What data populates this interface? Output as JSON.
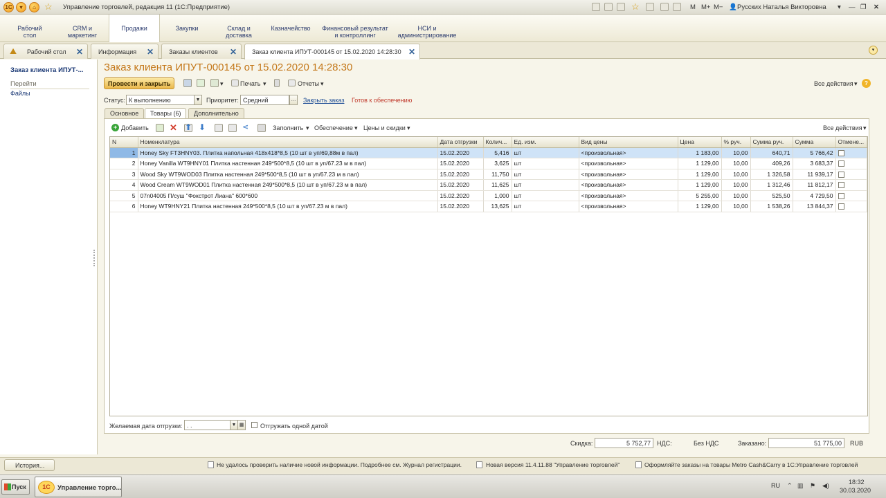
{
  "window": {
    "title": "Управление торговлей, редакция 11  (1С:Предприятие)",
    "memory_buttons": [
      "M",
      "M+",
      "M−"
    ],
    "user": "Русских Наталья Викторовна"
  },
  "sections": [
    {
      "label": "Рабочий\nстол"
    },
    {
      "label": "CRM и\nмаркетинг"
    },
    {
      "label": "Продажи"
    },
    {
      "label": "Закупки"
    },
    {
      "label": "Склад и\nдоставка"
    },
    {
      "label": "Казначейство"
    },
    {
      "label": "Финансовый результат\nи контроллинг"
    },
    {
      "label": "НСИ и\nадминистрирование"
    }
  ],
  "open_tabs": [
    {
      "label": "Рабочий стол"
    },
    {
      "label": "Информация"
    },
    {
      "label": "Заказы клиентов"
    },
    {
      "label": "Заказ клиента ИПУТ-000145 от 15.02.2020 14:28:30"
    }
  ],
  "navigation": {
    "title": "Заказ клиента ИПУТ-...",
    "goto": "Перейти",
    "files": "Файлы"
  },
  "form": {
    "title": "Заказ клиента ИПУТ-000145 от 15.02.2020 14:28:30",
    "toolbar": {
      "post_close": "Провести и закрыть",
      "print": "Печать",
      "reports": "Отчеты",
      "all_actions": "Все действия"
    },
    "status_label": "Статус:",
    "status_value": "К выполнению",
    "priority_label": "Приоритет:",
    "priority_value": "Средний",
    "close_order": "Закрыть заказ",
    "ready_text": "Готов к обеспечению",
    "ready_color": "#c0392b",
    "tabs": [
      "Основное",
      "Товары (6)",
      "Дополнительно"
    ],
    "grid_toolbar": {
      "add": "Добавить",
      "fill": "Заполнить",
      "supply": "Обеспечение",
      "prices": "Цены и скидки",
      "all_actions": "Все действия"
    },
    "columns": [
      "N",
      "Номенклатура",
      "Дата отгрузки",
      "Колич...",
      "Ед. изм.",
      "Вид цены",
      "Цена",
      "% руч.",
      "Сумма руч.",
      "Сумма",
      "Отмене..."
    ],
    "rows": [
      {
        "n": "1",
        "item": "Honey Sky FT3HNY03. Плитка напольная 418x418*8,5 (10 шт в уп/69,88м в пал)",
        "date": "15.02.2020",
        "qty": "5,416",
        "unit": "шт",
        "price_type": "<произвольная>",
        "price": "1 183,00",
        "pct": "10,00",
        "manual": "640,71",
        "sum": "5 766,42"
      },
      {
        "n": "2",
        "item": "Honey Vanilla WT9HNY01 Плитка настенная 249*500*8,5 (10 шт в уп/67.23 м в пал)",
        "date": "15.02.2020",
        "qty": "3,625",
        "unit": "шт",
        "price_type": "<произвольная>",
        "price": "1 129,00",
        "pct": "10,00",
        "manual": "409,26",
        "sum": "3 683,37"
      },
      {
        "n": "3",
        "item": "Wood Sky WT9WOD03 Плитка настенная 249*500*8,5 (10 шт в уп/67.23 м в пал)",
        "date": "15.02.2020",
        "qty": "11,750",
        "unit": "шт",
        "price_type": "<произвольная>",
        "price": "1 129,00",
        "pct": "10,00",
        "manual": "1 326,58",
        "sum": "11 939,17"
      },
      {
        "n": "4",
        "item": "Wood Cream WT9WOD01 Плитка настенная 249*500*8,5 (10 шт в уп/67.23 м в пал)",
        "date": "15.02.2020",
        "qty": "11,625",
        "unit": "шт",
        "price_type": "<произвольная>",
        "price": "1 129,00",
        "pct": "10,00",
        "manual": "1 312,46",
        "sum": "11 812,17"
      },
      {
        "n": "5",
        "item": "07n04005  П/суш \"Фокстрот Лиана\"  600*600",
        "date": "15.02.2020",
        "qty": "1,000",
        "unit": "шт",
        "price_type": "<произвольная>",
        "price": "5 255,00",
        "pct": "10,00",
        "manual": "525,50",
        "sum": "4 729,50"
      },
      {
        "n": "6",
        "item": "Honey WT9HNY21 Плитка настенная 249*500*8,5 (10 шт в уп/67.23 м в пал)",
        "date": "15.02.2020",
        "qty": "13,625",
        "unit": "шт",
        "price_type": "<произвольная>",
        "price": "1 129,00",
        "pct": "10,00",
        "manual": "1 538,26",
        "sum": "13 844,37"
      }
    ],
    "desired_date_label": "Желаемая дата отгрузки:",
    "desired_date_value": ". .",
    "ship_one_date": "Отгружать одной датой",
    "discount_label": "Скидка:",
    "discount_value": "5 752,77",
    "vat_label": "НДС:",
    "vat_value": "Без НДС",
    "ordered_label": "Заказано:",
    "ordered_value": "51 775,00",
    "currency": "RUB"
  },
  "statusbar": {
    "history": "История...",
    "messages": [
      "Не удалось проверить наличие новой информации. Подробнее см. Журнал регистрации.",
      "Новая версия 11.4.11.88 \"Управление торговлей\"",
      "Оформляйте заказы на товары Metro Cash&Carry в 1С:Управление торговлей"
    ]
  },
  "taskbar": {
    "start": "Пуск",
    "app_logo": "1С",
    "app": "Управление торго...",
    "lang": "RU",
    "time": "18:32",
    "date": "30.03.2020"
  },
  "colors": {
    "accent_title": "#c4781a",
    "link": "#1f4e96",
    "selection": "#cfe3f7"
  }
}
